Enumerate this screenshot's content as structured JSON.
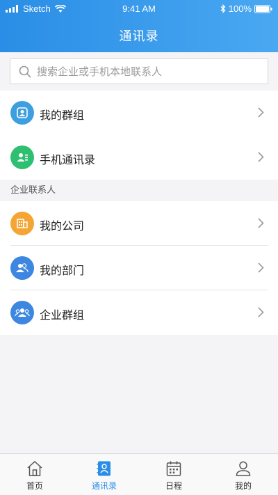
{
  "status_bar": {
    "carrier": "Sketch",
    "time": "9:41 AM",
    "battery": "100%"
  },
  "header": {
    "title": "通讯录"
  },
  "search": {
    "placeholder": "搜索企业或手机本地联系人"
  },
  "top_items": [
    {
      "label": "我的群组",
      "icon": "group-icon",
      "color": "#3d9fe0"
    },
    {
      "label": "手机通讯录",
      "icon": "contact-card-icon",
      "color": "#2fbf71"
    }
  ],
  "section_title": "企业联系人",
  "enterprise_items": [
    {
      "label": "我的公司",
      "icon": "building-icon",
      "color": "#f4a533"
    },
    {
      "label": "我的部门",
      "icon": "people-icon",
      "color": "#3d87e0"
    },
    {
      "label": "企业群组",
      "icon": "enterprise-group-icon",
      "color": "#3d87e0"
    }
  ],
  "tabs": [
    {
      "label": "首页",
      "icon": "home-icon",
      "active": false
    },
    {
      "label": "通讯录",
      "icon": "contacts-book-icon",
      "active": true
    },
    {
      "label": "日程",
      "icon": "calendar-icon",
      "active": false
    },
    {
      "label": "我的",
      "icon": "user-icon",
      "active": false
    }
  ],
  "colors": {
    "header_start": "#2a8ee6",
    "header_end": "#4aa8f2",
    "active_tab": "#2a8ee6"
  }
}
